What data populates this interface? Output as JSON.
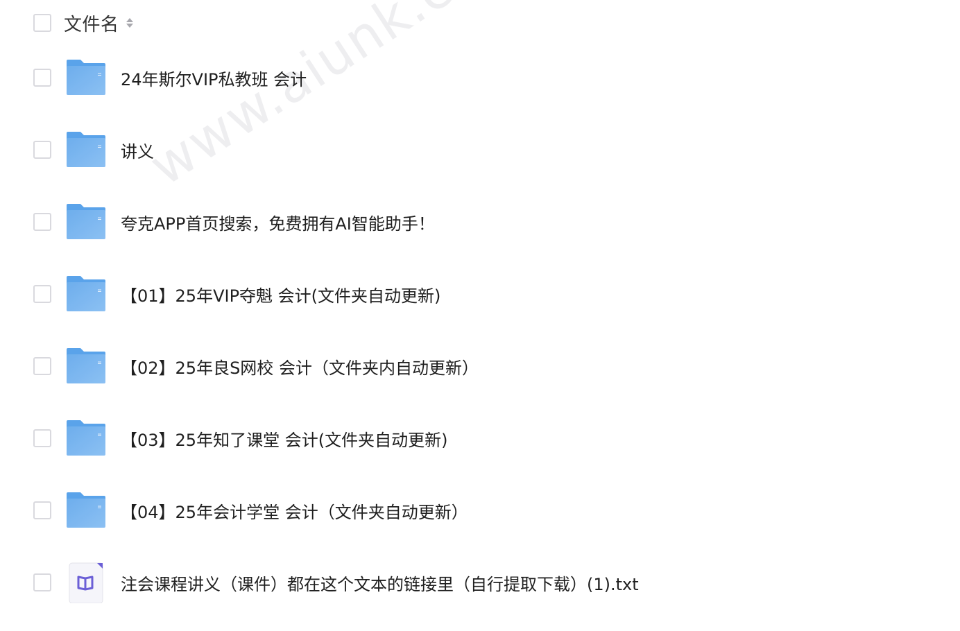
{
  "header": {
    "column_label": "文件名"
  },
  "files": [
    {
      "name": "24年斯尔VIP私教班 会计",
      "type": "folder"
    },
    {
      "name": "讲义",
      "type": "folder"
    },
    {
      "name": "夸克APP首页搜索，免费拥有AI智能助手！",
      "type": "folder"
    },
    {
      "name": "【01】25年VIP夺魁 会计(文件夹自动更新)",
      "type": "folder"
    },
    {
      "name": "【02】25年良S网校 会计（文件夹内自动更新）",
      "type": "folder"
    },
    {
      "name": "【03】25年知了课堂 会计(文件夹自动更新)",
      "type": "folder"
    },
    {
      "name": "【04】25年会计学堂 会计（文件夹自动更新）",
      "type": "folder"
    },
    {
      "name": "注会课程讲义（课件）都在这个文本的链接里（自行提取下载）(1).txt",
      "type": "txt"
    }
  ],
  "watermark": "www.aiunk.com",
  "colors": {
    "folder": "#7cb8f2",
    "folder_dark": "#5aa3ea",
    "txt_icon": "#6b5fd6",
    "checkbox_border": "#d9d9de"
  },
  "icons": {
    "folder": "folder-icon",
    "txt": "book-icon",
    "sort": "sort-icon"
  }
}
